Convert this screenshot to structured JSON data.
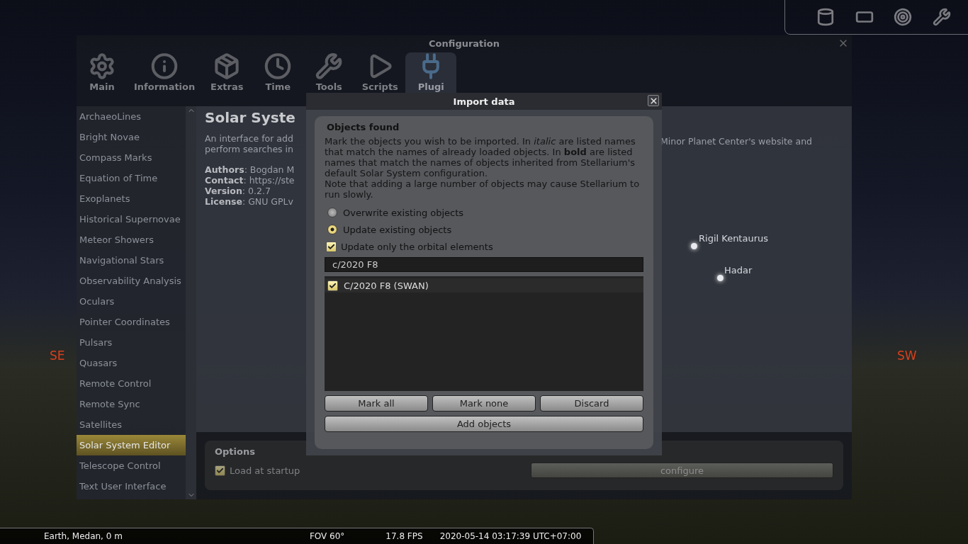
{
  "sky": {
    "labels": [
      {
        "text": "Rigil Kentaurus",
        "kind": "star"
      },
      {
        "text": "Hadar",
        "kind": "star"
      },
      {
        "text": "SE",
        "kind": "cardinal"
      },
      {
        "text": "SW",
        "kind": "cardinal"
      }
    ]
  },
  "config_window": {
    "title": "Configuration",
    "tabs": [
      {
        "label": "Main",
        "selected": false
      },
      {
        "label": "Information",
        "selected": false
      },
      {
        "label": "Extras",
        "selected": false
      },
      {
        "label": "Time",
        "selected": false
      },
      {
        "label": "Tools",
        "selected": false
      },
      {
        "label": "Scripts",
        "selected": false
      },
      {
        "label": "Plugi",
        "selected": true
      }
    ],
    "sidebar": {
      "items": [
        {
          "label": "ArchaeoLines",
          "selected": false
        },
        {
          "label": "Bright Novae",
          "selected": false
        },
        {
          "label": "Compass Marks",
          "selected": false
        },
        {
          "label": "Equation of Time",
          "selected": false
        },
        {
          "label": "Exoplanets",
          "selected": false
        },
        {
          "label": "Historical Supernovae",
          "selected": false
        },
        {
          "label": "Meteor Showers",
          "selected": false
        },
        {
          "label": "Navigational Stars",
          "selected": false
        },
        {
          "label": "Observability Analysis",
          "selected": false
        },
        {
          "label": "Oculars",
          "selected": false
        },
        {
          "label": "Pointer Coordinates",
          "selected": false
        },
        {
          "label": "Pulsars",
          "selected": false
        },
        {
          "label": "Quasars",
          "selected": false
        },
        {
          "label": "Remote Control",
          "selected": false
        },
        {
          "label": "Remote Sync",
          "selected": false
        },
        {
          "label": "Satellites",
          "selected": false
        },
        {
          "label": "Solar System Editor",
          "selected": true
        },
        {
          "label": "Telescope Control",
          "selected": false
        },
        {
          "label": "Text User Interface",
          "selected": false
        }
      ]
    },
    "plugin": {
      "title": "Solar Syste",
      "description_left": [
        "An interface for add",
        "perform searches in"
      ],
      "description_right": "Minor Planet Center's website and",
      "details": [
        "**Authors**: Bogdan M",
        "**Contact**: https://ste",
        "**Version**: 0.2.7",
        "**License**: GNU GPLv"
      ],
      "options": {
        "title": "Options",
        "load_at_startup": {
          "label": "Load at startup",
          "checked": true
        },
        "configure_button": "configure"
      }
    }
  },
  "import_dialog": {
    "title": "Import data",
    "section": "Objects found",
    "paragraphs": [
      "Mark the objects you wish to be imported. In *italic* are listed names that match the names of already loaded objects. In **bold** are listed names that match the names of objects inherited from Stellarium's default Solar System configuration.",
      "Note that adding a large number of objects may cause Stellarium to run slowly."
    ],
    "radios": [
      {
        "label": "Overwrite existing objects",
        "selected": false
      },
      {
        "label": "Update existing objects",
        "selected": true
      }
    ],
    "orbital_only": {
      "label": "Update only the orbital elements",
      "checked": true
    },
    "filter": {
      "value": "c/2020 F8"
    },
    "objects": [
      {
        "name": "C/2020 F8 (SWAN)",
        "checked": true
      }
    ],
    "buttons": [
      "Mark all",
      "Mark none",
      "Discard"
    ],
    "add_button": "Add objects"
  },
  "status_bar": {
    "location": "Earth, Medan, 0 m",
    "fov": "FOV 60°",
    "fps": "17.8 FPS",
    "datetime": "2020-05-14 03:17:39 UTC+07:00"
  }
}
